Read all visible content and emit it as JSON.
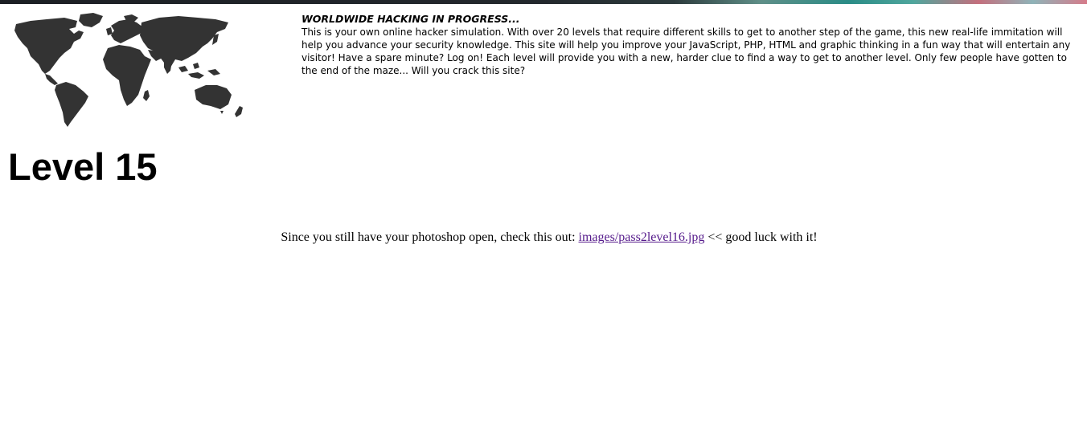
{
  "intro": {
    "title": "WORLDWIDE HACKING IN PROGRESS...",
    "text": "This is your own online hacker simulation. With over 20 levels that require different skills to get to another step of the game, this new real-life immitation will help you advance your security knowledge. This site will help you improve your JavaScript, PHP, HTML and graphic thinking in a fun way that will entertain any visitor! Have a spare minute? Log on! Each level will provide you with a new, harder clue to find a way to get to another level. Only few people have gotten to the end of the maze... Will you crack this site?"
  },
  "level": {
    "heading": "Level 15"
  },
  "hint": {
    "before": "Since you still have your photoshop open, check this out: ",
    "link_text": "images/pass2level16.jpg",
    "after": " << good luck with it!"
  },
  "colors": {
    "map_fill": "#333333",
    "visited_link": "#551a8b",
    "text": "#000000"
  },
  "icons": {
    "world_map": "world-map-icon"
  }
}
